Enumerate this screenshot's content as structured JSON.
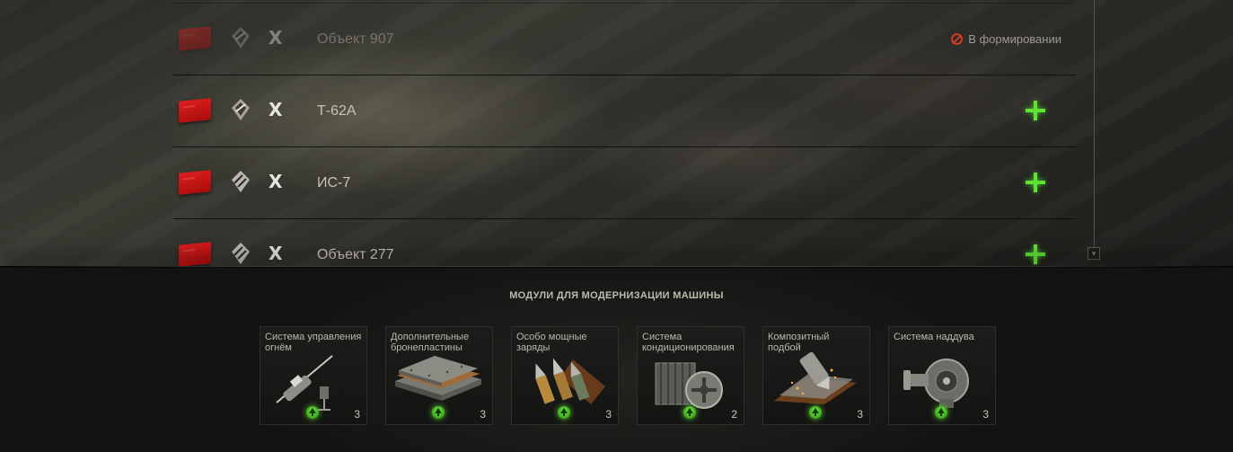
{
  "vehicles": [
    {
      "tier": "X",
      "name": "Объект 907",
      "status": "В формировании",
      "available": false
    },
    {
      "tier": "X",
      "name": "Т-62А",
      "status": "",
      "available": true
    },
    {
      "tier": "X",
      "name": "ИС-7",
      "status": "",
      "available": true
    },
    {
      "tier": "X",
      "name": "Объект 277",
      "status": "",
      "available": true
    }
  ],
  "modules": {
    "title": "МОДУЛИ ДЛЯ МОДЕРНИЗАЦИИ МАШИНЫ",
    "items": [
      {
        "label": "Система управления\nогнём",
        "count": "3"
      },
      {
        "label": "Дополнительные\nбронепластины",
        "count": "3"
      },
      {
        "label": "Особо мощные\nзаряды",
        "count": "3"
      },
      {
        "label": "Система\nкондиционирования",
        "count": "2"
      },
      {
        "label": "Композитный\nподбой",
        "count": "3"
      },
      {
        "label": "Система наддува",
        "count": "3"
      }
    ]
  },
  "colors": {
    "flag": "#e01e1e",
    "accent_green": "#5fe234",
    "forbidden": "#d23a2a"
  }
}
